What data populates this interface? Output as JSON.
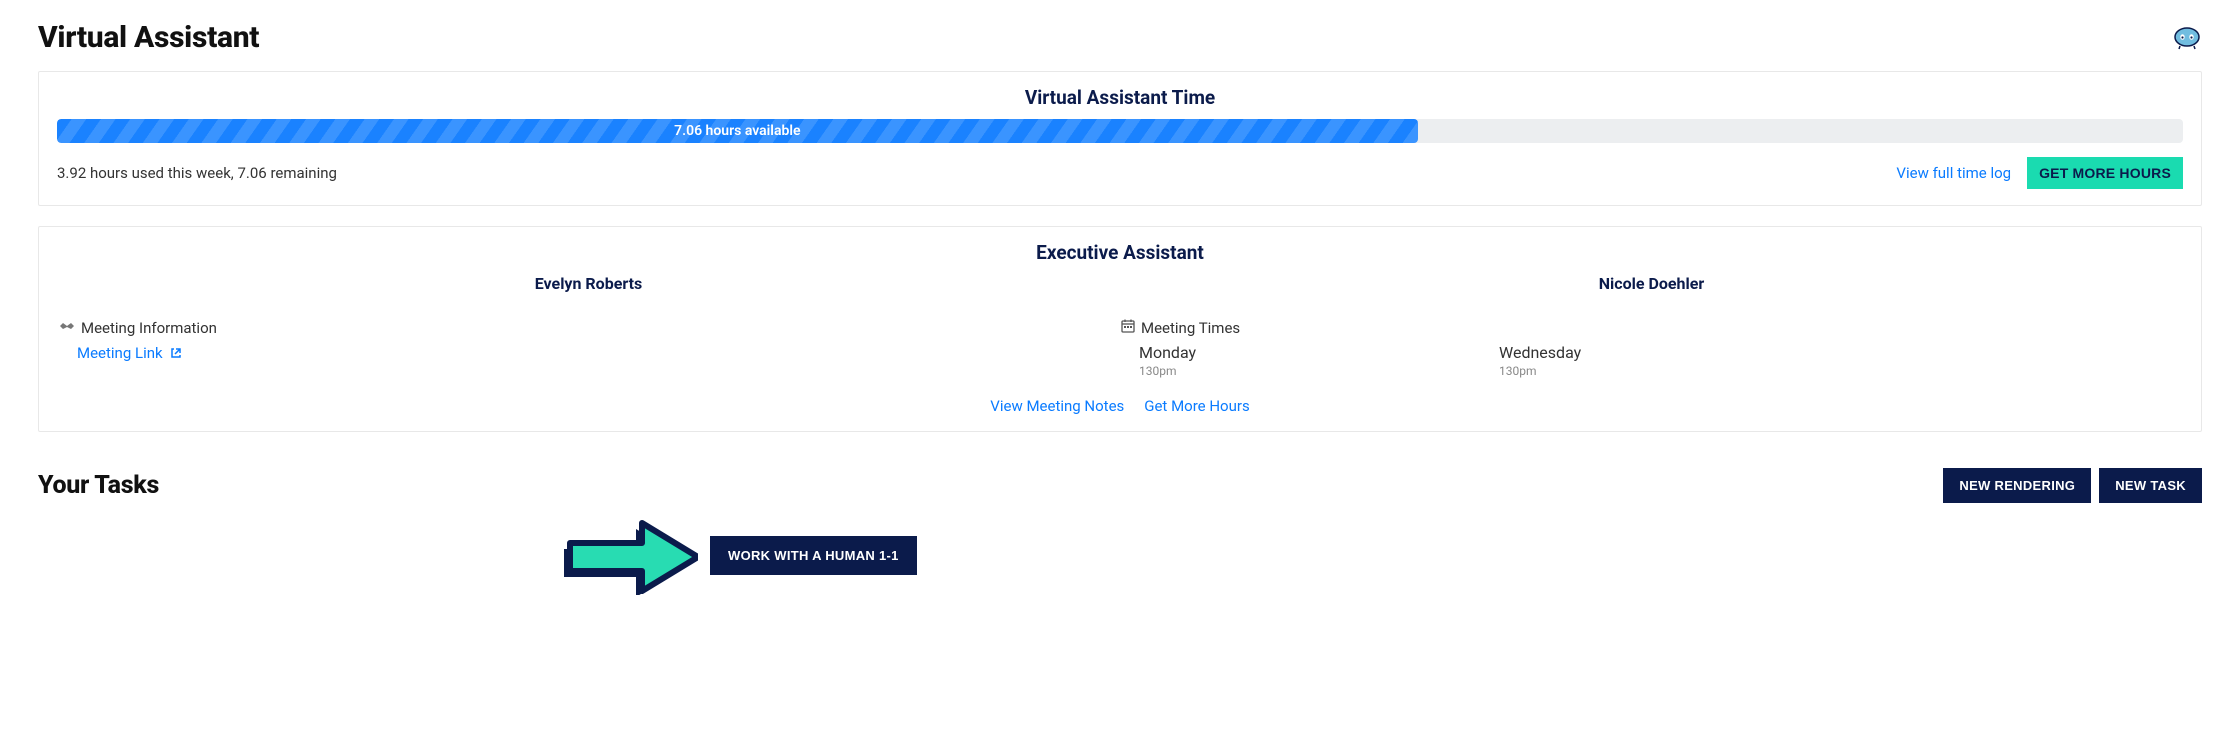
{
  "page": {
    "title": "Virtual Assistant"
  },
  "vat_card": {
    "title": "Virtual Assistant Time",
    "bar_label": "7.06 hours available",
    "status": "3.92 hours used this week, 7.06 remaining",
    "view_log": "View full time log",
    "get_hours": "GET MORE HOURS"
  },
  "ea_card": {
    "title": "Executive Assistant",
    "assistants": [
      {
        "name": "Evelyn Roberts"
      },
      {
        "name": "Nicole Doehler"
      }
    ],
    "meeting_info": {
      "title": "Meeting Information",
      "link_label": "Meeting Link"
    },
    "meeting_times": {
      "title": "Meeting Times",
      "slots": [
        {
          "day": "Monday",
          "time": "130pm"
        },
        {
          "day": "Wednesday",
          "time": "130pm"
        }
      ]
    },
    "footer": {
      "view_notes": "View Meeting Notes",
      "get_hours": "Get More Hours"
    }
  },
  "tasks": {
    "title": "Your Tasks",
    "new_rendering": "NEW RENDERING",
    "new_task": "NEW TASK",
    "work_human": "WORK WITH A HUMAN 1-1"
  }
}
